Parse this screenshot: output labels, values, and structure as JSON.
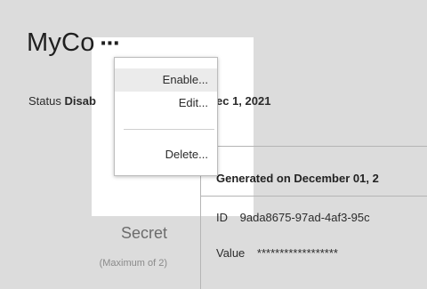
{
  "header": {
    "title": "MyCo",
    "more_label": "⋯"
  },
  "status": {
    "label": "Status",
    "value": "Disab",
    "date": "ec 1, 2021"
  },
  "menu": {
    "items": [
      "Enable...",
      "Edit...",
      "Delete..."
    ]
  },
  "secrets": {
    "generated": "Generated on December 01, 2",
    "id_label": "ID",
    "id_value": "9ada8675-97ad-4af3-95c",
    "value_label": "Value",
    "value_masked": "******************",
    "heading": "Secret",
    "note": "(Maximum of 2)"
  },
  "colors": {
    "page_background": "#dcdcdc",
    "panel_background": "#ffffff",
    "active_item": "#ebebeb"
  }
}
